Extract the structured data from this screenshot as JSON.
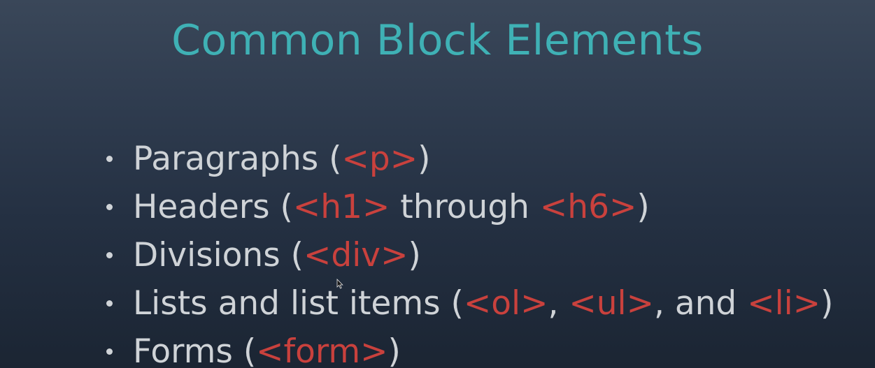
{
  "slide": {
    "title": "Common Block Elements",
    "bullets": [
      {
        "parts": [
          {
            "t": "Paragraphs (",
            "tag": false
          },
          {
            "t": "<p>",
            "tag": true
          },
          {
            "t": ")",
            "tag": false
          }
        ]
      },
      {
        "parts": [
          {
            "t": "Headers (",
            "tag": false
          },
          {
            "t": "<h1>",
            "tag": true
          },
          {
            "t": " through ",
            "tag": false
          },
          {
            "t": "<h6>",
            "tag": true
          },
          {
            "t": ")",
            "tag": false
          }
        ]
      },
      {
        "parts": [
          {
            "t": "Divisions (",
            "tag": false
          },
          {
            "t": "<div>",
            "tag": true
          },
          {
            "t": ")",
            "tag": false
          }
        ]
      },
      {
        "parts": [
          {
            "t": "Lists and list items (",
            "tag": false
          },
          {
            "t": "<ol>",
            "tag": true
          },
          {
            "t": ", ",
            "tag": false
          },
          {
            "t": "<ul>",
            "tag": true
          },
          {
            "t": ", and ",
            "tag": false
          },
          {
            "t": "<li>",
            "tag": true
          },
          {
            "t": ")",
            "tag": false
          }
        ]
      },
      {
        "parts": [
          {
            "t": "Forms (",
            "tag": false
          },
          {
            "t": "<form>",
            "tag": true
          },
          {
            "t": ")",
            "tag": false
          }
        ]
      }
    ]
  },
  "colors": {
    "title": "#3fb1b5",
    "text": "#cfd3d7",
    "tag": "#c9413d",
    "background": "#2f3c4f"
  },
  "icons": {
    "cursor": "mouse-pointer-icon"
  }
}
